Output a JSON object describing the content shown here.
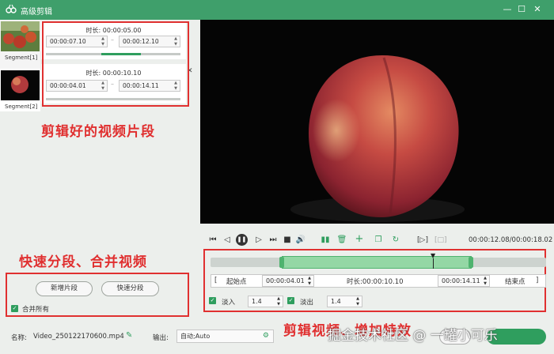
{
  "window": {
    "title": "高级剪辑"
  },
  "segments": [
    {
      "label": "Segment[1]",
      "duration_label": "时长:",
      "duration": "00:00:05.00",
      "start": "00:00:07.10",
      "end": "00:00:12.10"
    },
    {
      "label": "Segment[2]",
      "duration_label": "时长:",
      "duration": "00:00:10.10",
      "start": "00:00:04.01",
      "end": "00:00:14.11"
    }
  ],
  "annotations": {
    "segments_note": "剪辑好的视频片段",
    "split_note": "快速分段、合并视频",
    "edit_note": "剪辑视频、增加特效"
  },
  "left_actions": {
    "new_segment": "新增片段",
    "quick_split": "快速分段",
    "merge_all": "合并所有"
  },
  "player": {
    "time_display": "00:00:12.08/00:00:18.02"
  },
  "trim": {
    "start_point": "起始点",
    "start_time": "00:00:04.01",
    "duration_label": "时长:",
    "duration": "00:00:10.10",
    "end_time": "00:00:14.11",
    "end_point": "结束点",
    "fade_in_label": "淡入",
    "fade_in": "1.4",
    "fade_out_label": "淡出",
    "fade_out": "1.4"
  },
  "output": {
    "name_label": "名称:",
    "name": "Video_250122170600.mp4",
    "output_label": "输出:",
    "output_value": "自动;Auto"
  },
  "watermark": "掘金技术社区 @ 一罐小可乐",
  "colors": {
    "accent": "#3f9f6b",
    "annotation": "#e03030"
  }
}
